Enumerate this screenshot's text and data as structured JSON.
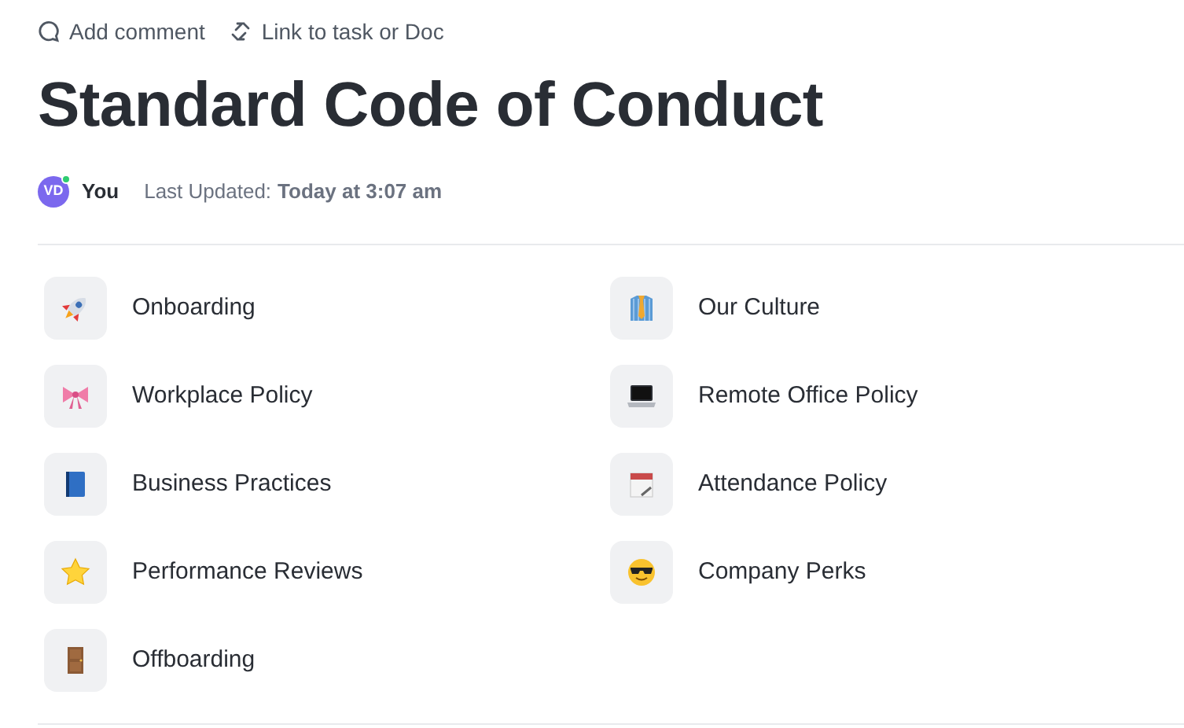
{
  "toolbar": [
    {
      "kind": "comment",
      "label": "Add comment"
    },
    {
      "kind": "link",
      "label": "Link to task or Doc"
    }
  ],
  "title": "Standard Code of Conduct",
  "meta": {
    "avatar": {
      "initials": "VD",
      "online": true
    },
    "author": "You",
    "updated_label": "Last Updated:",
    "updated_value": "Today at 3:07 am"
  },
  "pages": [
    {
      "kind": "rocket",
      "label": "Onboarding"
    },
    {
      "kind": "shirt",
      "label": "Our Culture"
    },
    {
      "kind": "bow",
      "label": "Workplace Policy"
    },
    {
      "kind": "laptop",
      "label": "Remote Office Policy"
    },
    {
      "kind": "book",
      "label": "Business Practices"
    },
    {
      "kind": "calendar",
      "label": "Attendance Policy"
    },
    {
      "kind": "star",
      "label": "Performance Reviews"
    },
    {
      "kind": "sunglasses",
      "label": "Company Perks"
    },
    {
      "kind": "door",
      "label": "Offboarding"
    }
  ]
}
